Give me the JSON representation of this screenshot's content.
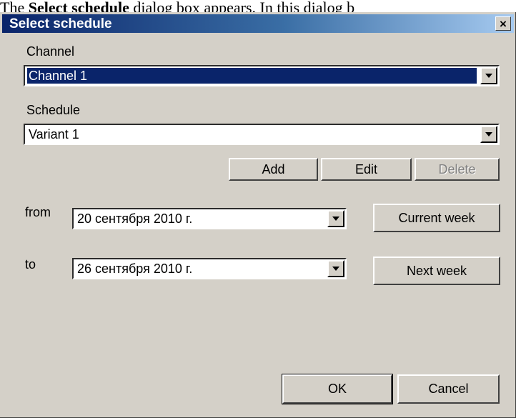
{
  "doc_caption": {
    "prefix": "The ",
    "bold": "Select schedule",
    "suffix": " dialog box appears. In this dialog b"
  },
  "dialog": {
    "title": "Select schedule",
    "close_glyph": "×"
  },
  "channel": {
    "label": "Channel",
    "value": "Channel 1"
  },
  "schedule": {
    "label": "Schedule",
    "value": "Variant 1",
    "buttons": {
      "add": "Add",
      "edit": "Edit",
      "delete": "Delete"
    }
  },
  "range": {
    "from_label": "from",
    "from_value": "20 сентября 2010 г.",
    "to_label": "to",
    "to_value": "26 сентября 2010 г.",
    "current_week": "Current week",
    "next_week": "Next week"
  },
  "footer": {
    "ok": "OK",
    "cancel": "Cancel"
  },
  "colors": {
    "dialog_bg": "#d4d0c8",
    "title_start": "#0a246a",
    "title_end": "#a6caf0",
    "selection": "#0a246a",
    "disabled_text": "#808080"
  },
  "icons": {
    "close": "close-icon",
    "dropdown": "chevron-down-icon"
  }
}
